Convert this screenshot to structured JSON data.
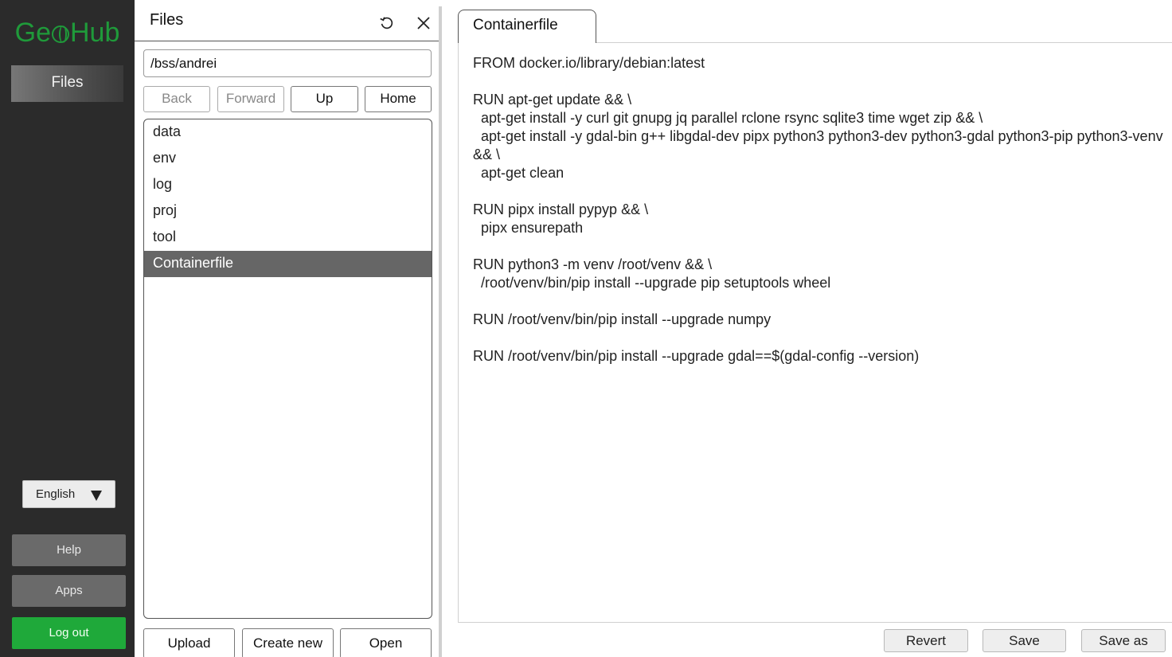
{
  "sidebar": {
    "logo_text_left": "Ge",
    "logo_text_right": "Hub",
    "nav_files_label": "Files",
    "language_label": "English",
    "help_label": "Help",
    "apps_label": "Apps",
    "logout_label": "Log out",
    "colors": {
      "brand": "#1f9a3a",
      "logout_bg": "#1fa93a",
      "background": "#2b2b2b"
    }
  },
  "files_panel": {
    "title": "Files",
    "path": "/bss/andrei",
    "buttons": {
      "back": "Back",
      "forward": "Forward",
      "up": "Up",
      "home": "Home",
      "upload": "Upload",
      "create_new": "Create new",
      "open": "Open"
    },
    "items": [
      {
        "name": "data"
      },
      {
        "name": "env"
      },
      {
        "name": "log"
      },
      {
        "name": "proj"
      },
      {
        "name": "tool"
      },
      {
        "name": "Containerfile"
      }
    ],
    "selected_index": 5,
    "icons": {
      "refresh": "refresh-icon",
      "close": "close-icon"
    }
  },
  "editor": {
    "tab_label": "Containerfile",
    "lines": [
      "FROM docker.io/library/debian:latest",
      "",
      "RUN apt-get update && \\",
      "  apt-get install -y curl git gnupg jq parallel rclone rsync sqlite3 time wget zip && \\",
      "  apt-get install -y gdal-bin g++ libgdal-dev pipx python3 python3-dev python3-gdal python3-pip python3-venv && \\",
      "  apt-get clean",
      "",
      "RUN pipx install pypyp && \\",
      "  pipx ensurepath",
      "",
      "RUN python3 -m venv /root/venv && \\",
      "  /root/venv/bin/pip install --upgrade pip setuptools wheel",
      "",
      "RUN /root/venv/bin/pip install --upgrade numpy",
      "",
      "RUN /root/venv/bin/pip install --upgrade gdal==$(gdal-config --version)"
    ],
    "buttons": {
      "revert": "Revert",
      "save": "Save",
      "save_as": "Save as"
    }
  }
}
